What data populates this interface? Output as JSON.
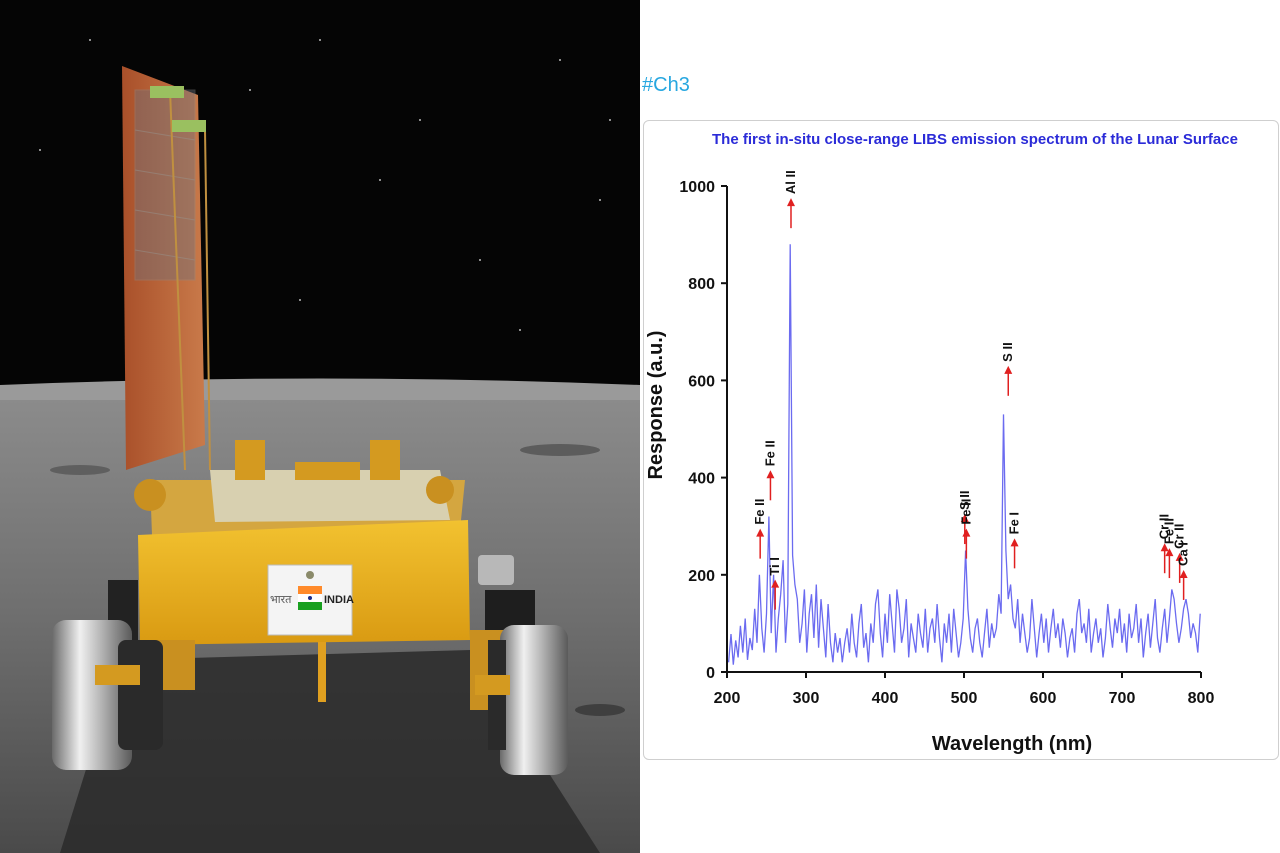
{
  "image": {
    "flag_text_left": "भारत",
    "flag_text_right": "INDIA"
  },
  "hashtag": "#Ch3",
  "chart_data": {
    "type": "line",
    "title": "The first in-situ close-range LIBS emission spectrum of the Lunar Surface",
    "xlabel": "Wavelength (nm)",
    "ylabel": "Response (a.u.)",
    "xlim": [
      200,
      800
    ],
    "ylim": [
      0,
      1000
    ],
    "xticks": [
      200,
      300,
      400,
      500,
      600,
      700,
      800
    ],
    "yticks": [
      0,
      200,
      400,
      600,
      800,
      1000
    ],
    "grid": false,
    "line_color": "#6b6bf0",
    "arrow_color": "#e02020",
    "series": [
      {
        "x": [
          202,
          205,
          208,
          211,
          214,
          217,
          220,
          223,
          226,
          229,
          232,
          235,
          238,
          241,
          244,
          247,
          250,
          253,
          256,
          259,
          262,
          265,
          268,
          271,
          274,
          277,
          280,
          283,
          286,
          289,
          292,
          295,
          298,
          301,
          304,
          307,
          310,
          313,
          316,
          319,
          322,
          325,
          328,
          331,
          334,
          337,
          340,
          343,
          346,
          349,
          352,
          355,
          358,
          361,
          364,
          367,
          370,
          373,
          376,
          379,
          382,
          385,
          388,
          391,
          394,
          397,
          400,
          403,
          406,
          409,
          412,
          415,
          418,
          421,
          424,
          427,
          430,
          433,
          436,
          439,
          442,
          445,
          448,
          451,
          454,
          457,
          460,
          463,
          466,
          469,
          472,
          475,
          478,
          481,
          484,
          487,
          490,
          493,
          496,
          499,
          502,
          505,
          508,
          511,
          514,
          517,
          520,
          523,
          526,
          529,
          532,
          535,
          538,
          541,
          544,
          547,
          550,
          553,
          556,
          559,
          562,
          565,
          568,
          571,
          574,
          577,
          580,
          583,
          586,
          589,
          592,
          595,
          598,
          601,
          604,
          607,
          610,
          613,
          616,
          619,
          622,
          625,
          628,
          631,
          634,
          637,
          640,
          643,
          646,
          649,
          652,
          655,
          658,
          661,
          664,
          667,
          670,
          673,
          676,
          679,
          682,
          685,
          688,
          691,
          694,
          697,
          700,
          703,
          706,
          709,
          712,
          715,
          718,
          721,
          724,
          727,
          730,
          733,
          736,
          739,
          742,
          745,
          748,
          751,
          754,
          757,
          760,
          763,
          766,
          769,
          772,
          775,
          778,
          781,
          784,
          787,
          790,
          793,
          796,
          799
        ],
        "values": [
          20,
          78,
          15,
          65,
          30,
          95,
          40,
          110,
          25,
          70,
          45,
          130,
          60,
          200,
          90,
          40,
          120,
          320,
          80,
          200,
          40,
          110,
          160,
          230,
          60,
          140,
          880,
          240,
          180,
          150,
          60,
          100,
          170,
          40,
          120,
          160,
          70,
          180,
          50,
          150,
          90,
          30,
          140,
          60,
          20,
          80,
          40,
          70,
          20,
          60,
          90,
          40,
          120,
          60,
          30,
          100,
          140,
          50,
          80,
          20,
          100,
          60,
          140,
          170,
          80,
          30,
          120,
          60,
          160,
          100,
          40,
          170,
          130,
          60,
          90,
          150,
          30,
          100,
          70,
          40,
          120,
          80,
          50,
          130,
          40,
          90,
          110,
          60,
          140,
          70,
          20,
          100,
          60,
          120,
          40,
          130,
          80,
          30,
          60,
          110,
          250,
          130,
          70,
          40,
          90,
          110,
          60,
          30,
          80,
          130,
          50,
          100,
          70,
          90,
          160,
          120,
          530,
          250,
          150,
          180,
          110,
          90,
          150,
          60,
          120,
          80,
          40,
          70,
          150,
          90,
          30,
          80,
          120,
          60,
          110,
          40,
          90,
          130,
          70,
          100,
          50,
          110,
          80,
          30,
          70,
          90,
          40,
          120,
          150,
          80,
          100,
          60,
          130,
          40,
          80,
          110,
          60,
          90,
          30,
          70,
          140,
          90,
          50,
          110,
          80,
          130,
          60,
          100,
          40,
          120,
          70,
          90,
          140,
          60,
          110,
          30,
          80,
          120,
          50,
          100,
          150,
          70,
          40,
          90,
          130,
          60,
          110,
          170,
          150,
          100,
          60,
          90,
          130,
          150,
          120,
          70,
          100,
          80,
          40,
          120
        ]
      }
    ],
    "annotations": [
      {
        "label": "Fe II",
        "x": 242,
        "tip": 295
      },
      {
        "label": "Fe II",
        "x": 255,
        "tip": 415
      },
      {
        "label": "Ti I",
        "x": 261,
        "tip": 190
      },
      {
        "label": "Al II",
        "x": 281,
        "tip": 975
      },
      {
        "label": "S II",
        "x": 501,
        "tip": 325
      },
      {
        "label": "Fe II",
        "x": 503,
        "tip": 295
      },
      {
        "label": "S II",
        "x": 556,
        "tip": 630
      },
      {
        "label": "Fe I",
        "x": 564,
        "tip": 275
      },
      {
        "label": "Cr II",
        "x": 754,
        "tip": 265
      },
      {
        "label": "Fe II",
        "x": 760,
        "tip": 255
      },
      {
        "label": "Cr II",
        "x": 773,
        "tip": 245
      },
      {
        "label": "Ca I",
        "x": 778,
        "tip": 210
      }
    ]
  }
}
